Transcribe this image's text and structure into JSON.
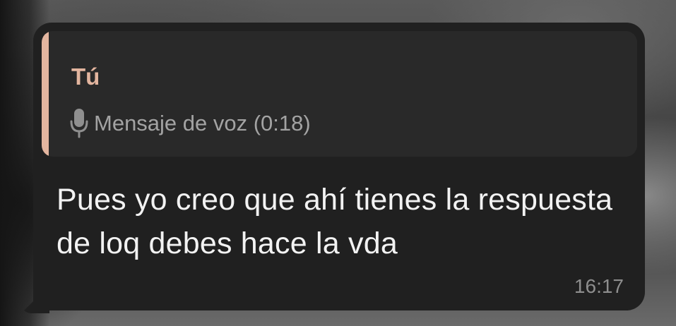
{
  "message": {
    "reply": {
      "author": "Tú",
      "icon": "microphone-icon",
      "text": "Mensaje de voz (0:18)",
      "accent_color": "#e3b59f"
    },
    "text": "Pues yo creo que ahí tienes la respuesta de loq debes hace la vda",
    "time": "16:17"
  }
}
